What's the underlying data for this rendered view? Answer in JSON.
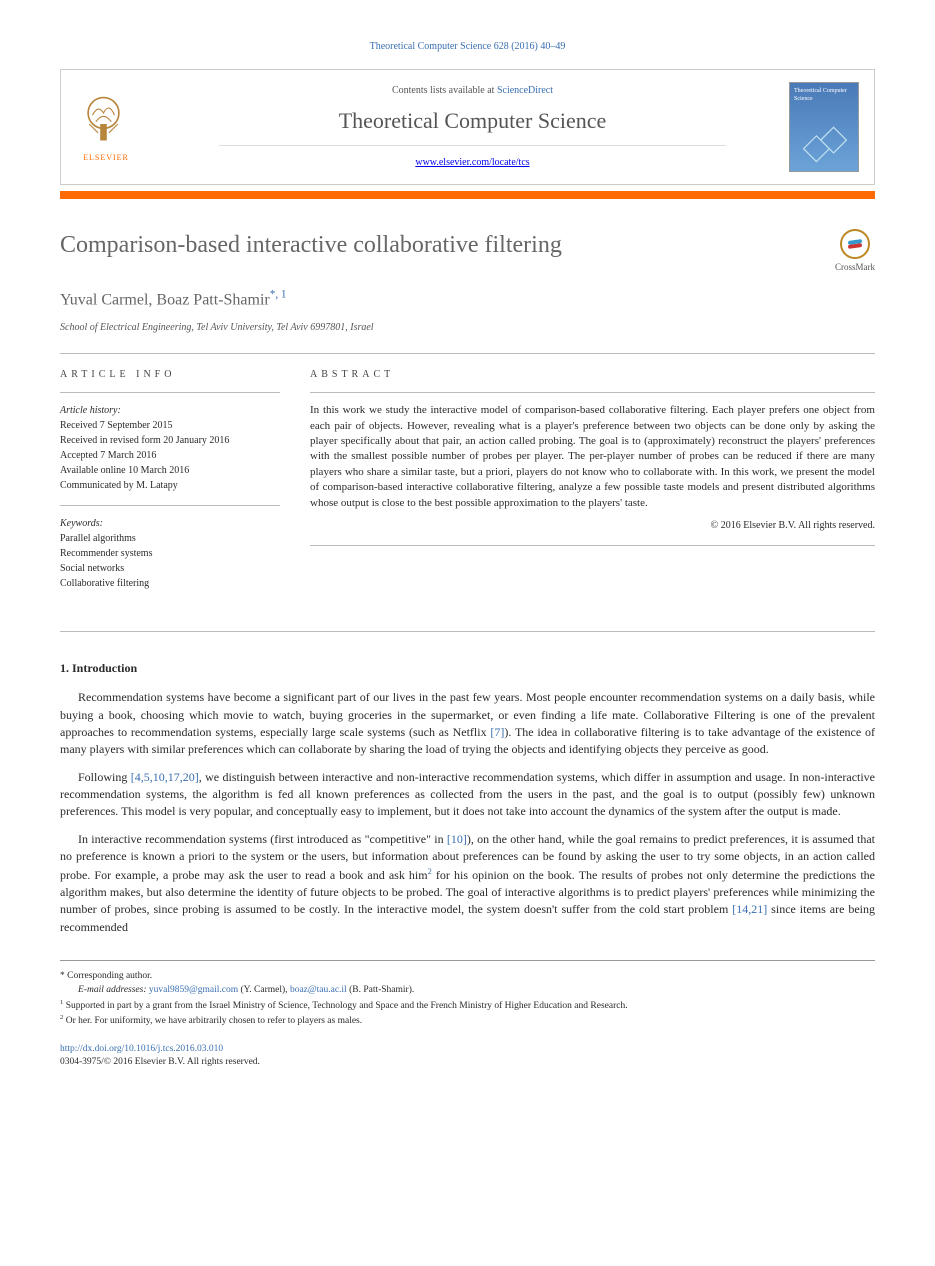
{
  "citation": "Theoretical Computer Science 628 (2016) 40–49",
  "header": {
    "contents_prefix": "Contents lists available at ",
    "contents_link": "ScienceDirect",
    "journal": "Theoretical Computer Science",
    "journal_url": "www.elsevier.com/locate/tcs",
    "publisher": "ELSEVIER",
    "cover_text": "Theoretical Computer Science"
  },
  "article": {
    "title": "Comparison-based interactive collaborative filtering",
    "crossmark": "CrossMark",
    "authors_prefix": "Yuval Carmel, Boaz Patt-Shamir",
    "author_marks": "*, 1",
    "affiliation": "School of Electrical Engineering, Tel Aviv University, Tel Aviv 6997801, Israel"
  },
  "info": {
    "heading": "ARTICLE INFO",
    "history_label": "Article history:",
    "history": [
      "Received 7 September 2015",
      "Received in revised form 20 January 2016",
      "Accepted 7 March 2016",
      "Available online 10 March 2016",
      "Communicated by M. Latapy"
    ],
    "keywords_label": "Keywords:",
    "keywords": [
      "Parallel algorithms",
      "Recommender systems",
      "Social networks",
      "Collaborative filtering"
    ]
  },
  "abstract": {
    "heading": "ABSTRACT",
    "text": "In this work we study the interactive model of comparison-based collaborative filtering. Each player prefers one object from each pair of objects. However, revealing what is a player's preference between two objects can be done only by asking the player specifically about that pair, an action called probing. The goal is to (approximately) reconstruct the players' preferences with the smallest possible number of probes per player. The per-player number of probes can be reduced if there are many players who share a similar taste, but a priori, players do not know who to collaborate with. In this work, we present the model of comparison-based interactive collaborative filtering, analyze a few possible taste models and present distributed algorithms whose output is close to the best possible approximation to the players' taste.",
    "copyright": "© 2016 Elsevier B.V. All rights reserved."
  },
  "sections": {
    "intro_heading": "1. Introduction",
    "p1_a": "Recommendation systems have become a significant part of our lives in the past few years. Most people encounter recommendation systems on a daily basis, while buying a book, choosing which movie to watch, buying groceries in the supermarket, or even finding a life mate. Collaborative Filtering is one of the prevalent approaches to recommendation systems, especially large scale systems (such as Netflix ",
    "p1_ref": "[7]",
    "p1_b": "). The idea in collaborative filtering is to take advantage of the existence of many players with similar preferences which can collaborate by sharing the load of trying the objects and identifying objects they perceive as good.",
    "p2_a": "Following ",
    "p2_ref": "[4,5,10,17,20]",
    "p2_b": ", we distinguish between interactive and non-interactive recommendation systems, which differ in assumption and usage. In non-interactive recommendation systems, the algorithm is fed all known preferences as collected from the users in the past, and the goal is to output (possibly few) unknown preferences. This model is very popular, and conceptually easy to implement, but it does not take into account the dynamics of the system after the output is made.",
    "p3_a": "In interactive recommendation systems (first introduced as \"competitive\" in ",
    "p3_ref1": "[10]",
    "p3_b": "), on the other hand, while the goal remains to predict preferences, it is assumed that no preference is known a priori to the system or the users, but information about preferences can be found by asking the user to try some objects, in an action called probe. For example, a probe may ask the user to read a book and ask him",
    "p3_fn": "2",
    "p3_c": " for his opinion on the book. The results of probes not only determine the predictions the algorithm makes, but also determine the identity of future objects to be probed. The goal of interactive algorithms is to predict players' preferences while minimizing the number of probes, since probing is assumed to be costly. In the interactive model, the system doesn't suffer from the cold start problem ",
    "p3_ref2": "[14,21]",
    "p3_d": " since items are being recommended"
  },
  "footnotes": {
    "corr": "* Corresponding author.",
    "email_label": "E-mail addresses: ",
    "email1": "yuval9859@gmail.com",
    "email1_who": " (Y. Carmel), ",
    "email2": "boaz@tau.ac.il",
    "email2_who": " (B. Patt-Shamir).",
    "fn1": "Supported in part by a grant from the Israel Ministry of Science, Technology and Space and the French Ministry of Higher Education and Research.",
    "fn2": "Or her. For uniformity, we have arbitrarily chosen to refer to players as males."
  },
  "footer": {
    "doi": "http://dx.doi.org/10.1016/j.tcs.2016.03.010",
    "issn_copyright": "0304-3975/© 2016 Elsevier B.V. All rights reserved."
  }
}
